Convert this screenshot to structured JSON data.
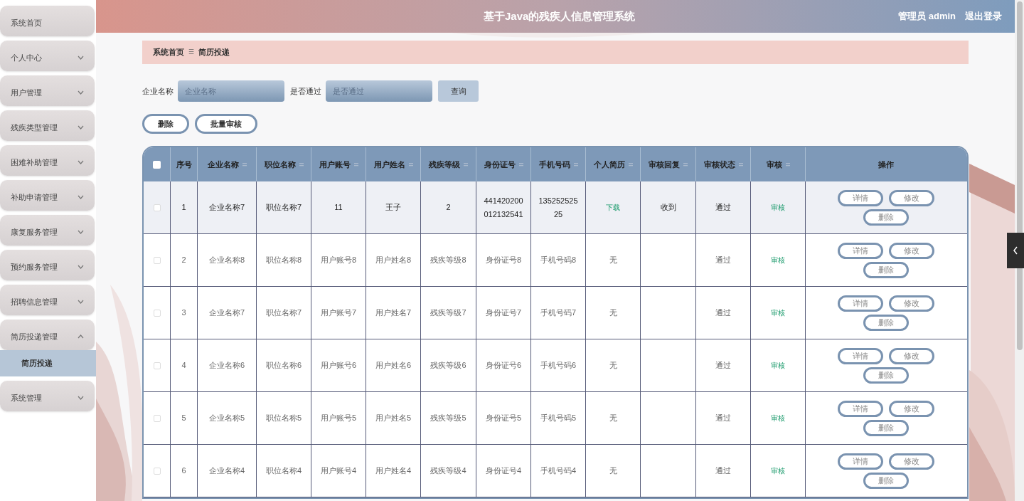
{
  "header": {
    "title": "基于Java的残疾人信息管理系统",
    "user": "管理员 admin",
    "logout": "退出登录"
  },
  "sidebar": {
    "items": [
      {
        "label": "系统首页",
        "kind": "link"
      },
      {
        "label": "个人中心",
        "kind": "menu",
        "expanded": false
      },
      {
        "label": "用户管理",
        "kind": "menu",
        "expanded": false
      },
      {
        "label": "残疾类型管理",
        "kind": "menu",
        "expanded": false
      },
      {
        "label": "困难补助管理",
        "kind": "menu",
        "expanded": false
      },
      {
        "label": "补助申请管理",
        "kind": "menu",
        "expanded": false
      },
      {
        "label": "康复服务管理",
        "kind": "menu",
        "expanded": false
      },
      {
        "label": "预约服务管理",
        "kind": "menu",
        "expanded": false
      },
      {
        "label": "招聘信息管理",
        "kind": "menu",
        "expanded": false
      },
      {
        "label": "简历投递管理",
        "kind": "menu",
        "expanded": true,
        "children": [
          {
            "label": "简历投递",
            "selected": true
          }
        ]
      },
      {
        "label": "系统管理",
        "kind": "menu",
        "expanded": false
      }
    ]
  },
  "breadcrumb": {
    "items": [
      "系统首页",
      "简历投递"
    ],
    "separator": "☰"
  },
  "search": {
    "fields": [
      {
        "label": "企业名称",
        "placeholder": "企业名称"
      },
      {
        "label": "是否通过",
        "placeholder": "是否通过"
      }
    ],
    "button": "查询"
  },
  "toolbar": [
    "删除",
    "批量审核"
  ],
  "table": {
    "select_all": {
      "checked": false
    },
    "columns": [
      {
        "label": "序号",
        "sortable": false
      },
      {
        "label": "企业名称",
        "sortable": true
      },
      {
        "label": "职位名称",
        "sortable": true
      },
      {
        "label": "用户账号",
        "sortable": true
      },
      {
        "label": "用户姓名",
        "sortable": true
      },
      {
        "label": "残疾等级",
        "sortable": true
      },
      {
        "label": "身份证号",
        "sortable": true
      },
      {
        "label": "手机号码",
        "sortable": true
      },
      {
        "label": "个人简历",
        "sortable": true
      },
      {
        "label": "审核回复",
        "sortable": true
      },
      {
        "label": "审核状态",
        "sortable": true
      },
      {
        "label": "审核",
        "sortable": true
      },
      {
        "label": "操作",
        "sortable": false
      }
    ],
    "rows": [
      {
        "checked": false,
        "highlighted": true,
        "cells": [
          "1",
          "企业名称7",
          "职位名称7",
          "11",
          "王子",
          "2",
          "441420200012132541",
          "13525252525"
        ],
        "resume": {
          "text": "下载",
          "kind": "link"
        },
        "reply": "收到",
        "status": "通过",
        "review": "审核",
        "actions": [
          "详情",
          "修改",
          "删除"
        ]
      },
      {
        "checked": false,
        "highlighted": false,
        "cells": [
          "2",
          "企业名称8",
          "职位名称8",
          "用户账号8",
          "用户姓名8",
          "残疾等级8",
          "身份证号8",
          "手机号码8"
        ],
        "resume": {
          "text": "无",
          "kind": "text"
        },
        "status": "通过",
        "review": "审核",
        "actions": [
          "详情",
          "修改",
          "删除"
        ]
      },
      {
        "checked": false,
        "highlighted": false,
        "cells": [
          "3",
          "企业名称7",
          "职位名称7",
          "用户账号7",
          "用户姓名7",
          "残疾等级7",
          "身份证号7",
          "手机号码7"
        ],
        "resume": {
          "text": "无",
          "kind": "text"
        },
        "status": "通过",
        "review": "审核",
        "actions": [
          "详情",
          "修改",
          "删除"
        ]
      },
      {
        "checked": false,
        "highlighted": false,
        "cells": [
          "4",
          "企业名称6",
          "职位名称6",
          "用户账号6",
          "用户姓名6",
          "残疾等级6",
          "身份证号6",
          "手机号码6"
        ],
        "resume": {
          "text": "无",
          "kind": "text"
        },
        "status": "通过",
        "review": "审核",
        "actions": [
          "详情",
          "修改",
          "删除"
        ]
      },
      {
        "checked": false,
        "highlighted": false,
        "cells": [
          "5",
          "企业名称5",
          "职位名称5",
          "用户账号5",
          "用户姓名5",
          "残疾等级5",
          "身份证号5",
          "手机号码5"
        ],
        "resume": {
          "text": "无",
          "kind": "text"
        },
        "status": "通过",
        "review": "审核",
        "actions": [
          "详情",
          "修改",
          "删除"
        ]
      },
      {
        "checked": false,
        "highlighted": false,
        "cells": [
          "6",
          "企业名称4",
          "职位名称4",
          "用户账号4",
          "用户姓名4",
          "残疾等级4",
          "身份证号4",
          "手机号码4"
        ],
        "resume": {
          "text": "无",
          "kind": "text"
        },
        "status": "通过",
        "review": "审核",
        "actions": [
          "详情",
          "修改",
          "删除"
        ]
      }
    ]
  }
}
